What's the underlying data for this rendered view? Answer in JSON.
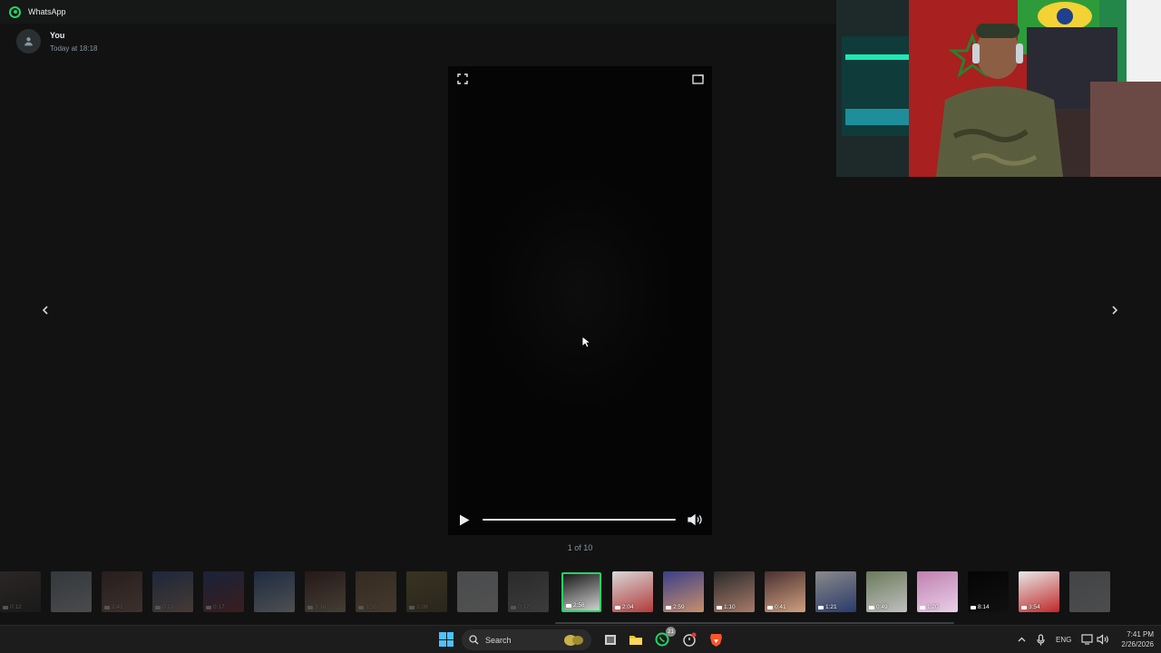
{
  "window": {
    "app_title": "WhatsApp"
  },
  "sender": {
    "name": "You",
    "timestamp": "Today at 18:18"
  },
  "viewer": {
    "counter": "1 of 10",
    "progress": 0.0
  },
  "thumbnails": [
    {
      "duration": "0:12",
      "faded": true
    },
    {
      "duration": "",
      "faded": true
    },
    {
      "duration": "2:41",
      "faded": true
    },
    {
      "duration": "0:22",
      "faded": true
    },
    {
      "duration": "0:17",
      "faded": true
    },
    {
      "duration": "",
      "faded": true
    },
    {
      "duration": "3:16",
      "faded": true
    },
    {
      "duration": "3:55",
      "faded": true
    },
    {
      "duration": "1:09",
      "faded": true
    },
    {
      "duration": "",
      "faded": true
    },
    {
      "duration": "0:17",
      "faded": true
    },
    {
      "duration": "2:58",
      "faded": false,
      "active": true
    },
    {
      "duration": "2:04",
      "faded": false
    },
    {
      "duration": "2:59",
      "faded": false
    },
    {
      "duration": "1:10",
      "faded": false
    },
    {
      "duration": "0:41",
      "faded": false
    },
    {
      "duration": "1:21",
      "faded": false
    },
    {
      "duration": "0:49",
      "faded": false
    },
    {
      "duration": "1:20",
      "faded": false
    },
    {
      "duration": "8:14",
      "faded": false
    },
    {
      "duration": "3:54",
      "faded": false
    },
    {
      "duration": "",
      "faded": true
    }
  ],
  "taskbar": {
    "search_label": "Search",
    "whatsapp_badge": "21",
    "language": "ENG",
    "time": "7:41 PM",
    "date": "2/26/2026"
  },
  "colors": {
    "accent": "#25d366",
    "background": "#121212",
    "titlebar": "#161717"
  }
}
